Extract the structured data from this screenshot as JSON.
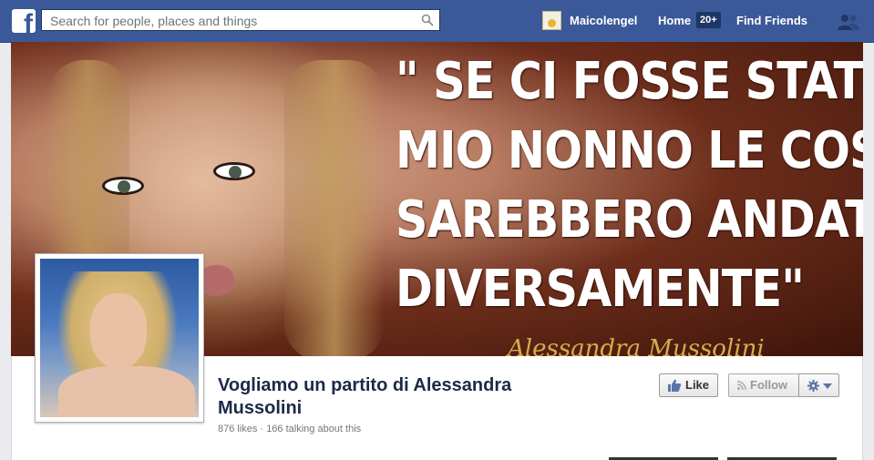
{
  "header": {
    "search_placeholder": "Search for people, places and things",
    "user_name": "Maicolengel",
    "home_label": "Home",
    "home_badge": "20+",
    "find_friends_label": "Find Friends"
  },
  "cover": {
    "quote_lines": [
      "\" SE CI FOSSE STATO",
      "MIO NONNO LE COSE",
      "SAREBBERO ANDATE",
      "DIVERSAMENTE\""
    ],
    "signature": "Alessandra Mussolini"
  },
  "page": {
    "title": "Vogliamo un partito di Alessandra Mussolini",
    "stats": "876 likes · 166 talking about this"
  },
  "actions": {
    "like_label": "Like",
    "follow_label": "Follow"
  },
  "colors": {
    "topbar": "#3b5998",
    "title": "#1c2a47"
  },
  "icons": [
    "facebook-logo-icon",
    "search-icon",
    "friends-icon",
    "thumbs-up-icon",
    "rss-icon",
    "gear-icon",
    "chevron-down-icon"
  ]
}
